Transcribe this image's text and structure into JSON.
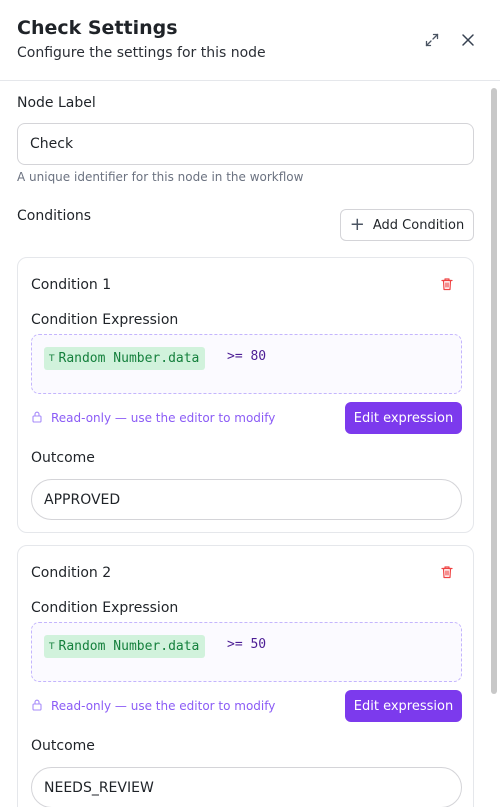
{
  "panel": {
    "title": "Check Settings",
    "subtitle": "Configure the settings for this node"
  },
  "icons": {
    "expand": "expand-icon",
    "close": "close-icon",
    "trash": "trash-icon",
    "lock": "lock-icon",
    "plus": "plus-icon"
  },
  "node_label": {
    "label": "Node Label",
    "value": "Check",
    "help": "A unique identifier for this node in the workflow"
  },
  "conditions": {
    "label": "Conditions",
    "add_label": "Add Condition",
    "items": [
      {
        "title": "Condition 1",
        "expr_label": "Condition Expression",
        "token_type": "T",
        "token": "Random Number.data",
        "operator": ">= 80",
        "readonly_note": "Read-only — use the editor to modify",
        "edit_label": "Edit expression",
        "outcome_label": "Outcome",
        "outcome": "APPROVED"
      },
      {
        "title": "Condition 2",
        "expr_label": "Condition Expression",
        "token_type": "T",
        "token": "Random Number.data",
        "operator": ">= 50",
        "readonly_note": "Read-only — use the editor to modify",
        "edit_label": "Edit expression",
        "outcome_label": "Outcome",
        "outcome": "NEEDS_REVIEW"
      }
    ]
  },
  "colors": {
    "accent": "#7c3aed",
    "token_bg": "#d1f2dc",
    "token_text": "#15803d",
    "danger": "#ef4444"
  }
}
